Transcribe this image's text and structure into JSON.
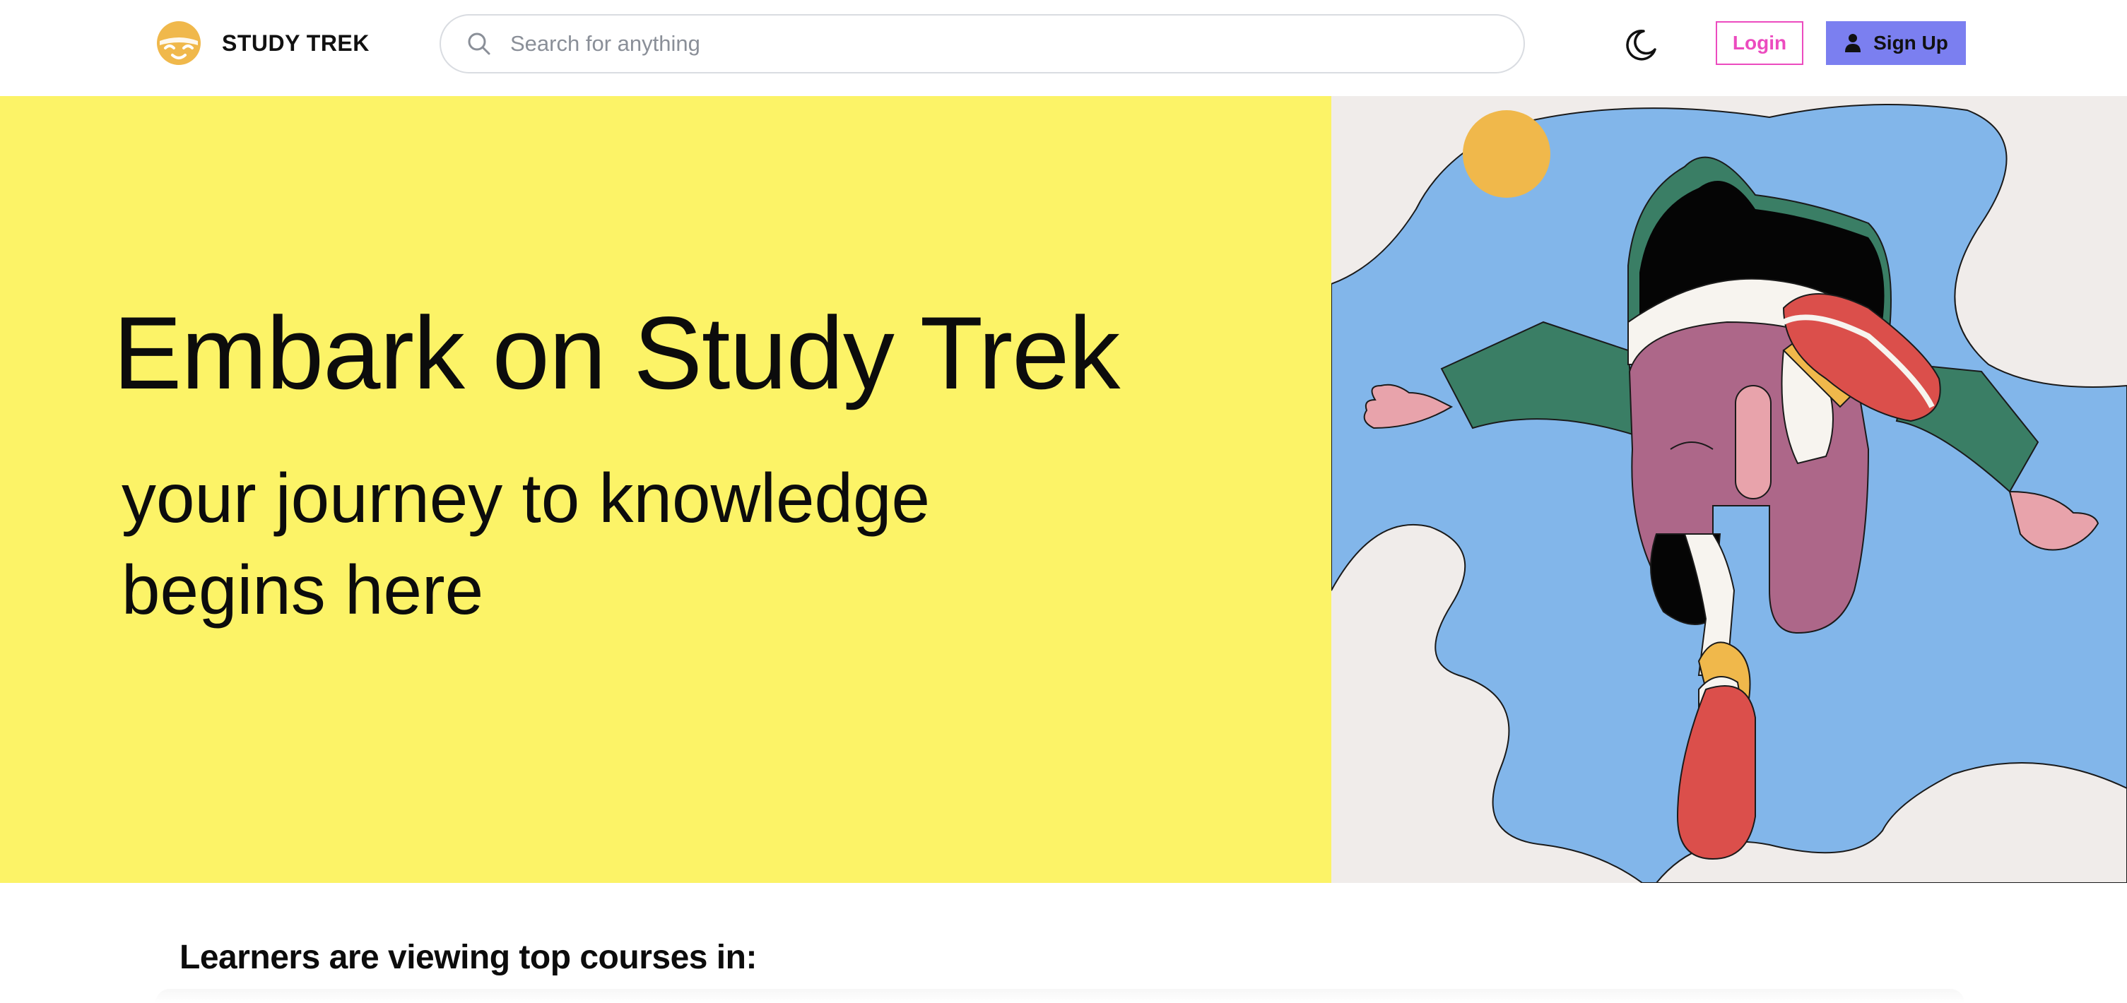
{
  "brand": {
    "name": "STUDY TREK",
    "logo_icon": "smiling-sun-face-icon",
    "logo_color": "#f0b84b"
  },
  "header": {
    "search": {
      "placeholder": "Search for anything",
      "value": "",
      "icon": "search-icon"
    },
    "theme_toggle_icon": "moon-icon",
    "login_label": "Login",
    "signup_label": "Sign Up",
    "signup_icon": "user-icon"
  },
  "hero": {
    "title": "Embark on Study Trek",
    "subtitle_line1": "your journey to knowledge",
    "subtitle_line2": "begins here",
    "illustration": "person-walking-illustration",
    "background_color": "#fcf367"
  },
  "courses_section": {
    "title": "Learners are viewing top courses in:"
  },
  "colors": {
    "accent_pink": "#ec4bbf",
    "accent_purple": "#7b7ff0",
    "hero_yellow": "#fcf367",
    "illustration_blue": "#82b6ea"
  }
}
